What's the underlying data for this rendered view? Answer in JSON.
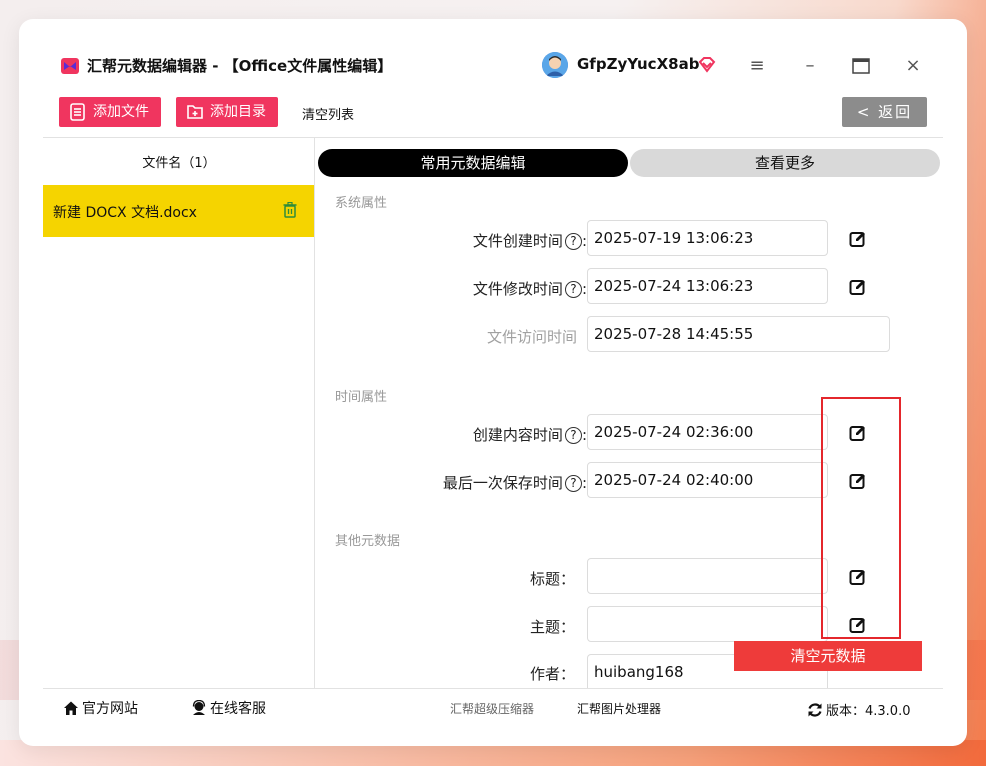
{
  "window": {
    "title": "汇帮元数据编辑器 - 【Office文件属性编辑】",
    "username": "GfpZyYucX8ab",
    "controls": [
      "≡",
      "–",
      "□",
      "×"
    ]
  },
  "toolbar": {
    "add_file": "添加文件",
    "add_dir": "添加目录",
    "clear_list": "清空列表",
    "back": "< 返回"
  },
  "file_list": {
    "header": "文件名（1）",
    "items": [
      {
        "name": "新建 DOCX 文档.docx"
      }
    ]
  },
  "tabs": {
    "common": "常用元数据编辑",
    "more": "查看更多"
  },
  "sections": {
    "system": "系统属性",
    "time": "时间属性",
    "other": "其他元数据"
  },
  "fields": {
    "created": {
      "label": "文件创建时间",
      "value": "2025-07-19 13:06:23"
    },
    "modified": {
      "label": "文件修改时间",
      "value": "2025-07-24 13:06:23"
    },
    "accessed": {
      "label": "文件访问时间",
      "value": "2025-07-28 14:45:55"
    },
    "content_created": {
      "label": "创建内容时间",
      "value": "2025-07-24 02:36:00"
    },
    "last_saved": {
      "label": "最后一次保存时间",
      "value": "2025-07-24 02:40:00"
    },
    "title": {
      "label": "标题：",
      "value": ""
    },
    "subject": {
      "label": "主题：",
      "value": ""
    },
    "author": {
      "label": "作者：",
      "value": "huibang168"
    }
  },
  "colon": ":",
  "help_glyph": "?",
  "clear_meta": "清空元数据",
  "footer": {
    "website": "官方网站",
    "support": "在线客服",
    "compressor": "汇帮超级压缩器",
    "image_tool": "汇帮图片处理器",
    "version": "版本：4.3.0.0"
  },
  "colors": {
    "accent_red": "#f0355f",
    "selected_file": "#f5d400",
    "annotation_red": "#e4272c"
  }
}
